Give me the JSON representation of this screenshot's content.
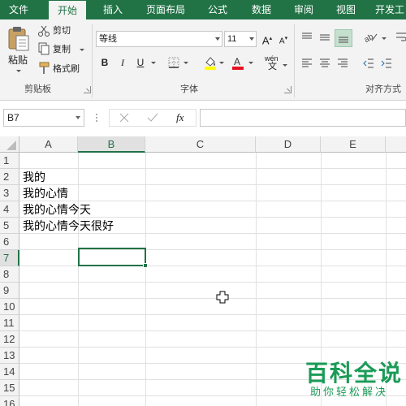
{
  "tabs": [
    {
      "label": "文件",
      "active": false
    },
    {
      "label": "开始",
      "active": true
    },
    {
      "label": "插入",
      "active": false
    },
    {
      "label": "页面布局",
      "active": false
    },
    {
      "label": "公式",
      "active": false
    },
    {
      "label": "数据",
      "active": false
    },
    {
      "label": "审阅",
      "active": false
    },
    {
      "label": "视图",
      "active": false
    },
    {
      "label": "开发工",
      "active": false
    }
  ],
  "clipboard": {
    "paste_label": "粘贴",
    "cut_label": "剪切",
    "copy_label": "复制",
    "format_painter_label": "格式刷",
    "group_label": "剪贴板"
  },
  "font": {
    "font_name": "等线",
    "font_size": "11",
    "bold_label": "B",
    "italic_label": "I",
    "underline_label": "U",
    "phonetic_label": "wén",
    "group_label": "字体",
    "fill_color": "#ffff00",
    "font_color": "#e81123"
  },
  "alignment": {
    "group_label": "对齐方式"
  },
  "formula_bar": {
    "name_box": "B7",
    "formula_value": "",
    "fx_label": "fx"
  },
  "sheet": {
    "columns": [
      "A",
      "B",
      "C",
      "D",
      "E"
    ],
    "selected_column": "B",
    "rows": [
      "1",
      "2",
      "3",
      "4",
      "5",
      "6",
      "7",
      "8",
      "9",
      "10",
      "11",
      "12",
      "13",
      "14",
      "15",
      "16"
    ],
    "selected_row": "7",
    "cells": {
      "A2": "我的",
      "A3": "我的心情",
      "A4": "我的心情今天",
      "A5": "我的心情今天很好"
    }
  },
  "watermark": {
    "title": "百科全说",
    "subtitle": "助你轻松解决"
  },
  "colors": {
    "accent": "#217346",
    "watermark": "#1a9b57"
  }
}
